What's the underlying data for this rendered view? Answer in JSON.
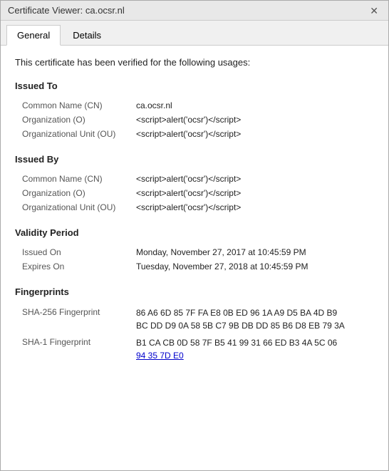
{
  "titleBar": {
    "title": "Certificate Viewer: ca.ocsr.nl",
    "closeLabel": "✕"
  },
  "tabs": [
    {
      "label": "General",
      "active": true
    },
    {
      "label": "Details",
      "active": false
    }
  ],
  "content": {
    "verifiedText": "This certificate has been verified for the following usages:",
    "issuedTo": {
      "sectionTitle": "Issued To",
      "fields": [
        {
          "label": "Common Name (CN)",
          "value": "ca.ocsr.nl"
        },
        {
          "label": "Organization (O)",
          "value": "<script>alert('ocsr')</script>"
        },
        {
          "label": "Organizational Unit (OU)",
          "value": "<script>alert('ocsr')</script>"
        }
      ]
    },
    "issuedBy": {
      "sectionTitle": "Issued By",
      "fields": [
        {
          "label": "Common Name (CN)",
          "value": "<script>alert('ocsr')</script>"
        },
        {
          "label": "Organization (O)",
          "value": "<script>alert('ocsr')</script>"
        },
        {
          "label": "Organizational Unit (OU)",
          "value": "<script>alert('ocsr')</script>"
        }
      ]
    },
    "validityPeriod": {
      "sectionTitle": "Validity Period",
      "fields": [
        {
          "label": "Issued On",
          "value": "Monday, November 27, 2017 at 10:45:59 PM"
        },
        {
          "label": "Expires On",
          "value": "Tuesday, November 27, 2018 at 10:45:59 PM"
        }
      ]
    },
    "fingerprints": {
      "sectionTitle": "Fingerprints",
      "items": [
        {
          "label": "SHA-256 Fingerprint",
          "lines": [
            "86 A6 6D 85 7F FA E8 0B ED 96 1A A9 D5 BA 4D B9",
            "BC DD D9 0A 58 5B C7 9B DB DD 85 B6 D8 EB 79 3A"
          ]
        },
        {
          "label": "SHA-1 Fingerprint",
          "lines": [
            "B1 CA CB 0D 58 7F B5 41 99 31 66 ED B3 4A 5C 06",
            "94 35 7D E0"
          ],
          "highlightLastLine": true
        }
      ]
    }
  }
}
